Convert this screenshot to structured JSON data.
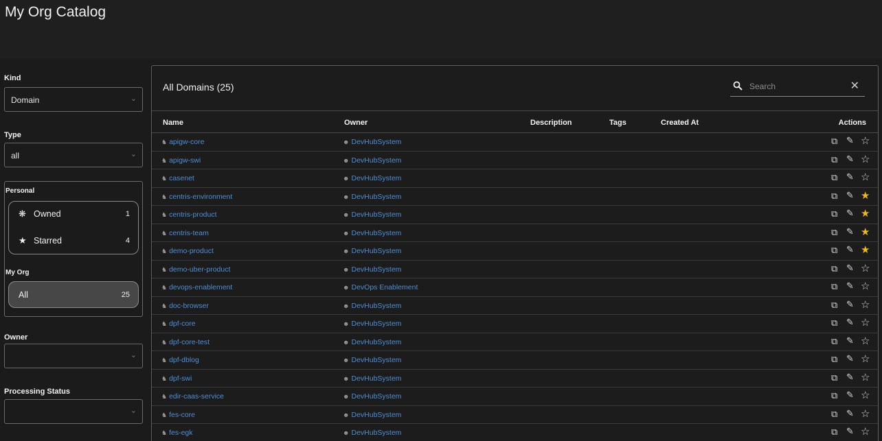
{
  "app": {
    "title": "My Org Catalog"
  },
  "filters": {
    "kind": {
      "label": "Kind",
      "value": "Domain"
    },
    "type": {
      "label": "Type",
      "value": "all"
    },
    "personal": {
      "label": "Personal",
      "owned": {
        "label": "Owned",
        "count": "1"
      },
      "starred": {
        "label": "Starred",
        "count": "4"
      }
    },
    "my_org": {
      "label": "My Org",
      "all": {
        "label": "All",
        "count": "25"
      }
    },
    "owner": {
      "label": "Owner",
      "value": ""
    },
    "processing_status": {
      "label": "Processing Status",
      "value": ""
    }
  },
  "table": {
    "title": "All Domains (25)",
    "search": {
      "placeholder": "Search"
    },
    "columns": {
      "name": "Name",
      "owner": "Owner",
      "description": "Description",
      "tags": "Tags",
      "created_at": "Created At",
      "actions": "Actions"
    },
    "rows": [
      {
        "name": "apigw-core",
        "owner": "DevHubSystem",
        "starred": false
      },
      {
        "name": "apigw-swi",
        "owner": "DevHubSystem",
        "starred": false
      },
      {
        "name": "casenet",
        "owner": "DevHubSystem",
        "starred": false
      },
      {
        "name": "centris-environment",
        "owner": "DevHubSystem",
        "starred": true
      },
      {
        "name": "centris-product",
        "owner": "DevHubSystem",
        "starred": true
      },
      {
        "name": "centris-team",
        "owner": "DevHubSystem",
        "starred": true
      },
      {
        "name": "demo-product",
        "owner": "DevHubSystem",
        "starred": true
      },
      {
        "name": "demo-uber-product",
        "owner": "DevHubSystem",
        "starred": false
      },
      {
        "name": "devops-enablement",
        "owner": "DevOps Enablement",
        "starred": false
      },
      {
        "name": "doc-browser",
        "owner": "DevHubSystem",
        "starred": false
      },
      {
        "name": "dpf-core",
        "owner": "DevHubSystem",
        "starred": false
      },
      {
        "name": "dpf-core-test",
        "owner": "DevHubSystem",
        "starred": false
      },
      {
        "name": "dpf-dblog",
        "owner": "DevHubSystem",
        "starred": false
      },
      {
        "name": "dpf-swi",
        "owner": "DevHubSystem",
        "starred": false
      },
      {
        "name": "edir-caas-service",
        "owner": "DevHubSystem",
        "starred": false
      },
      {
        "name": "fes-core",
        "owner": "DevHubSystem",
        "starred": false
      },
      {
        "name": "fes-egk",
        "owner": "DevHubSystem",
        "starred": false
      }
    ]
  },
  "icons": {
    "domain": "domain-icon",
    "group": "group-icon",
    "view": "open-in-new-icon",
    "edit": "pencil-icon",
    "star": "star-icon"
  },
  "colors": {
    "link": "#4f8fd6",
    "star_active": "#f2b818",
    "background": "#1b1b1b"
  }
}
